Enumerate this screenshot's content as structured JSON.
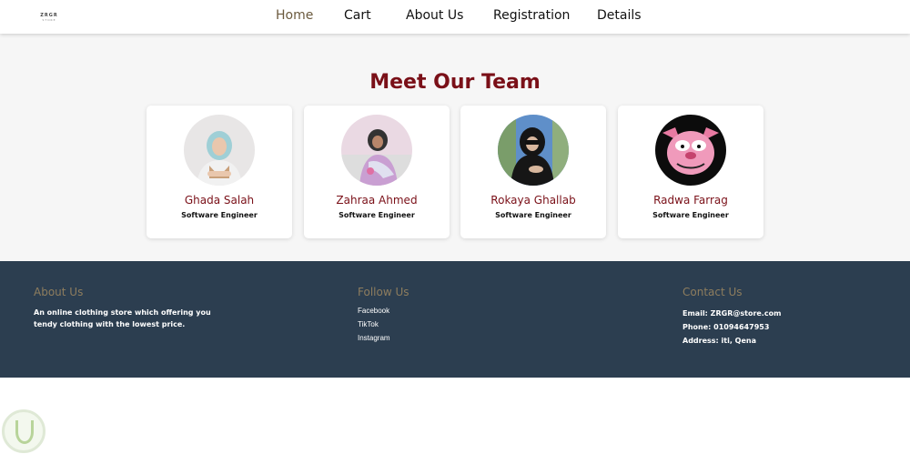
{
  "logo": {
    "mark": "ZRGR",
    "sub": "STORE"
  },
  "nav": {
    "home": "Home",
    "cart": "Cart",
    "about": "About Us",
    "registration": "Registration",
    "details": "Details"
  },
  "team": {
    "title": "Meet Our Team",
    "members": [
      {
        "name": "Ghada Salah",
        "role": "Software Engineer"
      },
      {
        "name": "Zahraa Ahmed",
        "role": "Software Engineer"
      },
      {
        "name": "Rokaya Ghallab",
        "role": "Software Engineer"
      },
      {
        "name": "Radwa Farrag",
        "role": "Software Engineer"
      }
    ]
  },
  "footer": {
    "about": {
      "title": "About Us",
      "text": "An online clothing store which offering you tendy clothing with the lowest price."
    },
    "follow": {
      "title": "Follow Us",
      "links": [
        "Facebook",
        "TikTok",
        "Instagram"
      ]
    },
    "contact": {
      "title": "Contact Us",
      "email": "Email: ZRGR@store.com",
      "phone": "Phone: 01094647953",
      "address": "Address: iti, Qena"
    }
  },
  "colors": {
    "accent": "#7a1018",
    "footer_bg": "#2c3e50",
    "footer_heading": "#8e7d5e",
    "nav_active": "#6b5a3e"
  }
}
